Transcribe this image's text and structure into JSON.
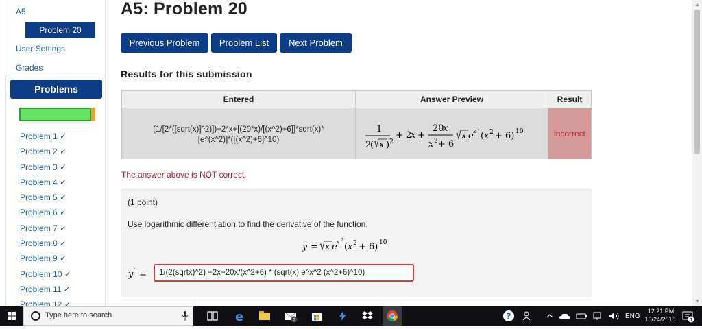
{
  "sidebar": {
    "nav": {
      "set_link": "A5",
      "active_problem": "Problem 20",
      "user_settings": "User Settings",
      "grades": "Grades"
    },
    "problems_header": "Problems",
    "progress_fraction": 0.95,
    "problem_items": [
      "Problem 1 ✓",
      "Problem 2 ✓",
      "Problem 3 ✓",
      "Problem 4 ✓",
      "Problem 5 ✓",
      "Problem 6 ✓",
      "Problem 7 ✓",
      "Problem 8 ✓",
      "Problem 9 ✓",
      "Problem 10 ✓",
      "Problem 11 ✓",
      "Problem 12 ✓"
    ]
  },
  "main": {
    "title": "A5: Problem 20",
    "buttons": {
      "previous": "Previous Problem",
      "list": "Problem List",
      "next": "Next Problem"
    },
    "results_heading": "Results for this submission",
    "table": {
      "headers": [
        "Entered",
        "Answer Preview",
        "Result"
      ],
      "entered_line1": "(1/[2*([sqrt(x)]^2)])+2*x+[(20*x)/[(x^2)+6]]*sqrt(x)*",
      "entered_line2": "[e^(x^2)]*([(x^2)+6]^10)",
      "result": "incorrect"
    },
    "incorrect_message": "The answer above is NOT correct.",
    "problem": {
      "points": "(1 point)",
      "instructions": "Use logarithmic differentiation to find the derivative of the function.",
      "answer_value": "1/(2(sqrtx)^2) +2x+20x/(x^2+6) * (sqrt(x) e^x^2 (x^2+6)^10)"
    }
  },
  "taskbar": {
    "search_placeholder": "Type here to search",
    "language": "ENG",
    "time": "12:21 PM",
    "date": "10/24/2018",
    "notification_count": "1",
    "mail_badge": "2"
  },
  "colors": {
    "nav_blue": "#0d3d87",
    "link_blue": "#1f5f97",
    "incorrect_red": "#b22222",
    "result_bg": "#d49a9a",
    "progress_green": "#62e562"
  }
}
